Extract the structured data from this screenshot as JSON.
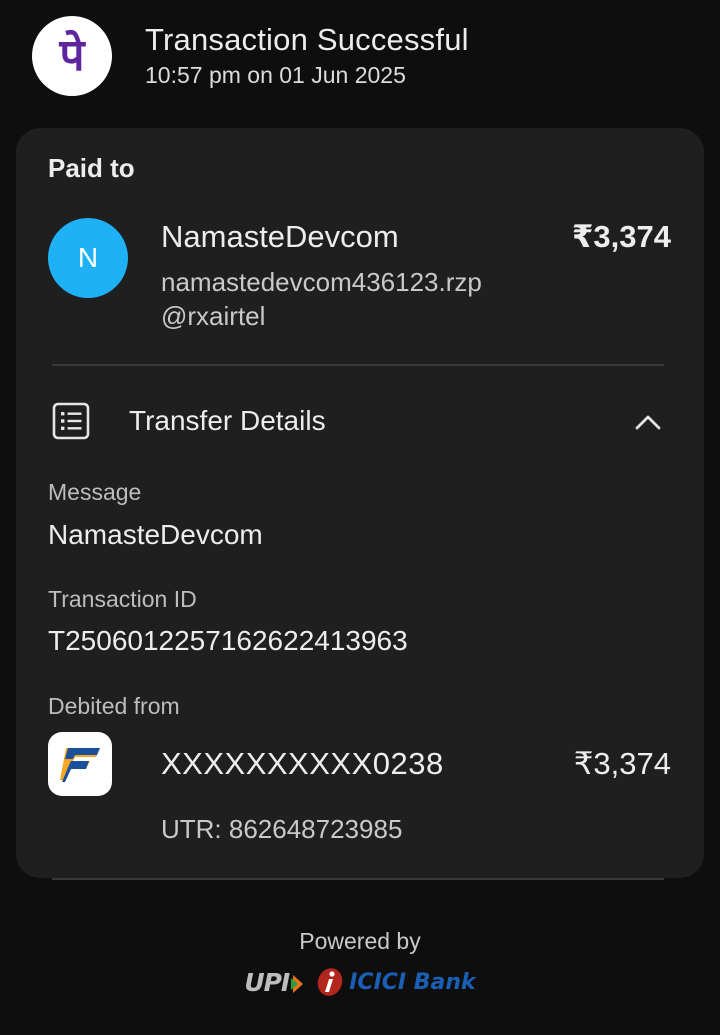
{
  "header": {
    "app_logo_icon": "phonepe-logo-icon",
    "app_logo_glyph": "पे",
    "title": "Transaction Successful",
    "datetime": "10:57 pm on 01 Jun 2025"
  },
  "paid_to": {
    "label": "Paid to",
    "avatar_initial": "N",
    "avatar_color": "#1fb1f5",
    "name": "NamasteDevcom",
    "vpa": "namastedevcom436123.rzp@rxairtel",
    "amount": "₹3,374"
  },
  "transfer_details": {
    "title": "Transfer Details",
    "icon": "receipt-list-icon",
    "toggle_icon": "chevron-up-icon",
    "message_label": "Message",
    "message_value": "NamasteDevcom",
    "transaction_id_label": "Transaction ID",
    "transaction_id_value": "T2506012257162622413963",
    "debited_from_label": "Debited from",
    "bank_logo_icon": "federal-bank-logo-icon",
    "account_number": "XXXXXXXXXX0238",
    "debited_amount": "₹3,374",
    "utr": "UTR: 862648723985"
  },
  "footer": {
    "powered_by": "Powered by",
    "upi_logo_text": "UPI",
    "bank_logo_text": "ICICI Bank"
  },
  "colors": {
    "background": "#0e0e0e",
    "card": "#1f1f1f",
    "brand_purple": "#5f259f",
    "icici_blue": "#1a5fb4",
    "icici_orange": "#e8731a"
  }
}
